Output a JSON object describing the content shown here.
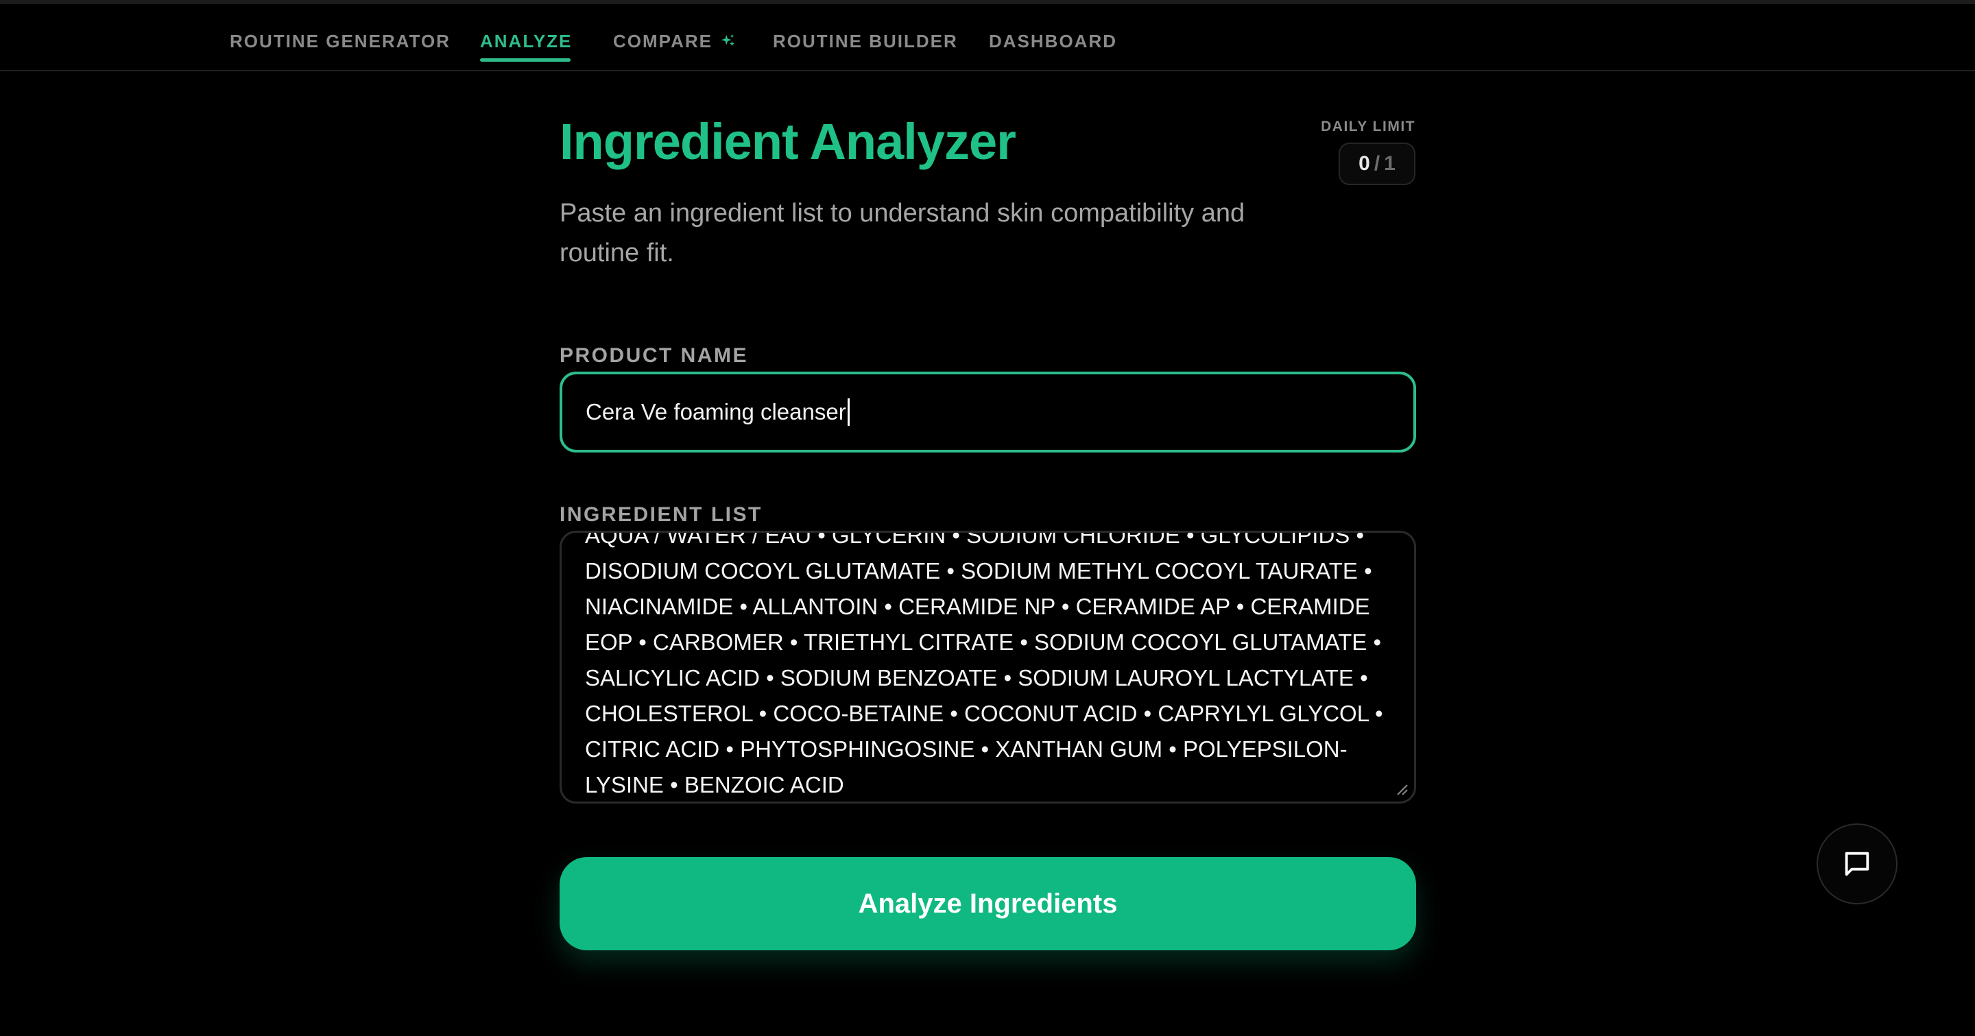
{
  "nav": {
    "items": [
      {
        "label": "ROUTINE GENERATOR"
      },
      {
        "label": "ANALYZE"
      },
      {
        "label": "COMPARE"
      },
      {
        "label": "ROUTINE BUILDER"
      },
      {
        "label": "DASHBOARD"
      }
    ],
    "active": "ANALYZE",
    "compare_icon": "sparkle-icon"
  },
  "header": {
    "title": "Ingredient Analyzer",
    "subtitle": "Paste an ingredient list to understand skin compatibility and routine fit."
  },
  "daily_limit": {
    "label": "DAILY LIMIT",
    "used": "0",
    "separator": "/",
    "total": "1"
  },
  "form": {
    "product_name_label": "PRODUCT NAME",
    "product_name_value": "Cera Ve foaming cleanser",
    "ingredient_list_label": "INGREDIENT LIST",
    "ingredient_list_value": "AQUA / WATER / EAU • GLYCERIN • SODIUM CHLORIDE • GLYCOLIPIDS • DISODIUM COCOYL GLUTAMATE • SODIUM METHYL COCOYL TAURATE • NIACINAMIDE • ALLANTOIN • CERAMIDE NP • CERAMIDE AP • CERAMIDE EOP • CARBOMER • TRIETHYL CITRATE • SODIUM COCOYL GLUTAMATE • SALICYLIC ACID • SODIUM BENZOATE • SODIUM LAUROYL LACTYLATE • CHOLESTEROL • COCO-BETAINE • COCONUT ACID • CAPRYLYL GLYCOL • CITRIC ACID • PHYTOSPHINGOSINE • XANTHAN GUM • POLYEPSILON-LYSINE • BENZOIC ACID",
    "submit_label": "Analyze Ingredients"
  },
  "chat": {
    "icon": "chat-bubble-icon"
  },
  "colors": {
    "accent": "#10b981",
    "accent_text": "#20c186",
    "background": "#000000"
  }
}
